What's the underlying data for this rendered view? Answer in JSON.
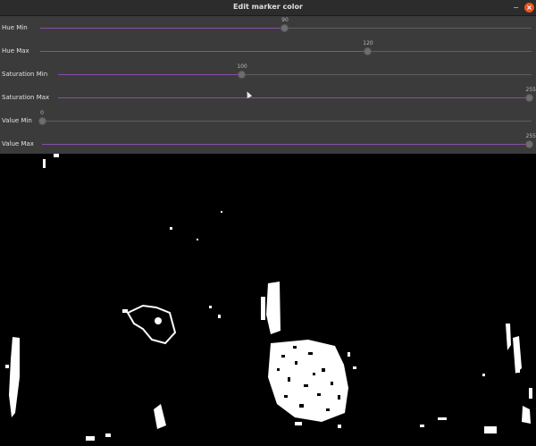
{
  "window": {
    "title": "Edit marker color"
  },
  "sliders": [
    {
      "label": "Hue Min",
      "value": "90"
    },
    {
      "label": "Hue Max",
      "value": "120"
    },
    {
      "label": "Saturation Min",
      "value": "100"
    },
    {
      "label": "Saturation Max",
      "value": "255"
    },
    {
      "label": "Value Min",
      "value": "0"
    },
    {
      "label": "Value Max",
      "value": "255"
    }
  ],
  "colors": {
    "accent": "#8a4ea8",
    "close": "#e95420"
  }
}
